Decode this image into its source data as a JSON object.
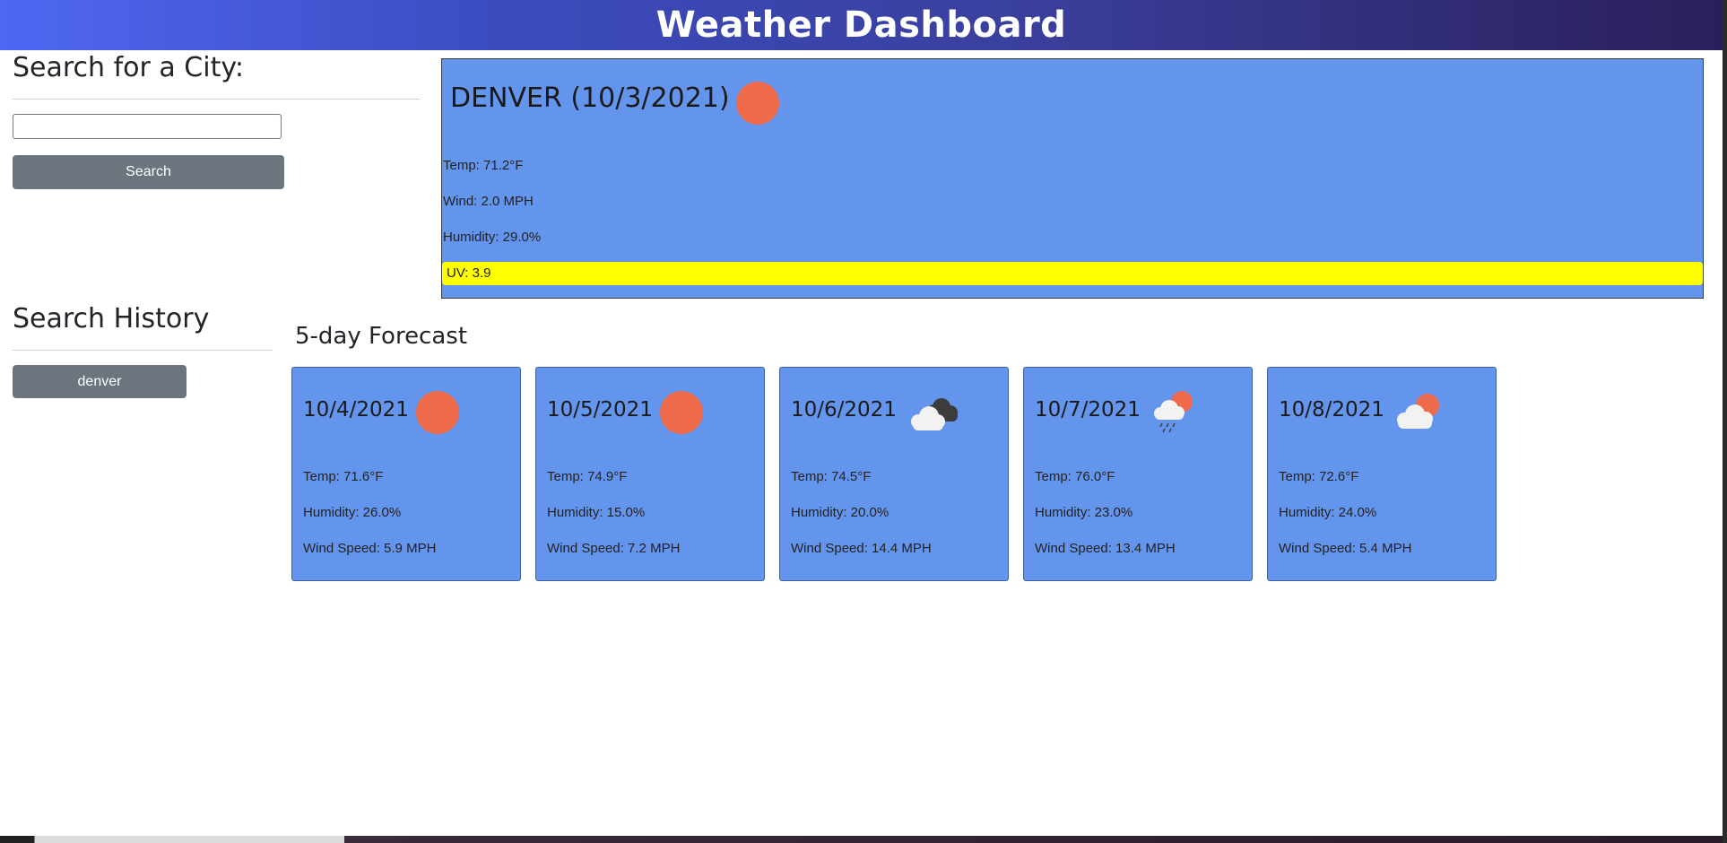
{
  "header": {
    "title": "Weather Dashboard"
  },
  "search": {
    "heading": "Search for a City:",
    "input_value": "",
    "button_label": "Search"
  },
  "history": {
    "heading": "Search History",
    "items": [
      {
        "label": "denver"
      }
    ]
  },
  "current": {
    "title": "DENVER (10/3/2021)",
    "icon": "sun-icon",
    "temp": "Temp: 71.2°F",
    "wind": "Wind: 2.0 MPH",
    "humidity": "Humidity: 29.0%",
    "uv": "UV: 3.9",
    "uv_color": "#ffff00"
  },
  "forecast": {
    "heading": "5-day Forecast",
    "days": [
      {
        "date": "10/4/2021",
        "icon": "sun-icon",
        "temp": "Temp: 71.6°F",
        "humidity": "Humidity: 26.0%",
        "wind": "Wind Speed: 5.9 MPH"
      },
      {
        "date": "10/5/2021",
        "icon": "sun-icon",
        "temp": "Temp: 74.9°F",
        "humidity": "Humidity: 15.0%",
        "wind": "Wind Speed: 7.2 MPH"
      },
      {
        "date": "10/6/2021",
        "icon": "cloudy-icon",
        "temp": "Temp: 74.5°F",
        "humidity": "Humidity: 20.0%",
        "wind": "Wind Speed: 14.4 MPH"
      },
      {
        "date": "10/7/2021",
        "icon": "rain-sun-icon",
        "temp": "Temp: 76.0°F",
        "humidity": "Humidity: 23.0%",
        "wind": "Wind Speed: 13.4 MPH"
      },
      {
        "date": "10/8/2021",
        "icon": "partly-cloudy-icon",
        "temp": "Temp: 72.6°F",
        "humidity": "Humidity: 24.0%",
        "wind": "Wind Speed: 5.4 MPH"
      }
    ]
  },
  "colors": {
    "card_bg": "#6495ed",
    "button_bg": "#6c757d",
    "sun": "#ee6a4b",
    "header_start": "#4f67f2",
    "header_end": "#2a1f5a"
  }
}
